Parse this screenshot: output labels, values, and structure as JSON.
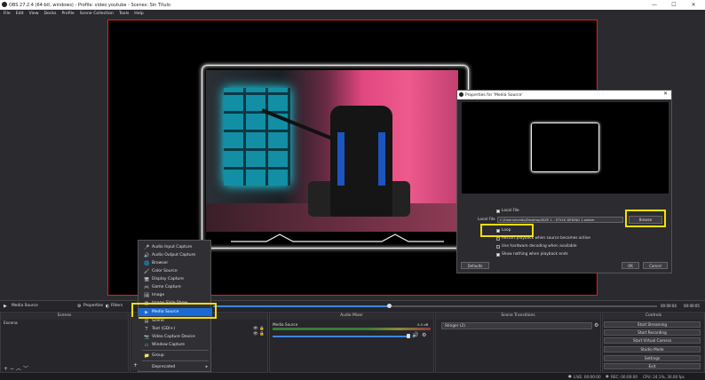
{
  "window": {
    "title": "OBS 27.2.4 (64-bit, windows) - Profile: video youtube - Scenes: Sin Título",
    "minimize": "—",
    "maximize": "☐",
    "close": "✕"
  },
  "menu": [
    "File",
    "Edit",
    "View",
    "Docks",
    "Profile",
    "Scene Collection",
    "Tools",
    "Help"
  ],
  "dialog": {
    "title": "Properties for 'Media Source'",
    "close": "✕",
    "local_file_label": "Local File",
    "local_file_field_label": "Local File",
    "local_file_value": "C:/Users/ivaldo/Desktop/SIZE 1 - STYLE DESING 1.webm",
    "browse": "Browse",
    "loop": "Loop",
    "restart": "Restart playback when source becomes active",
    "hw_decoding": "Use hardware decoding when available",
    "show_nothing": "Show nothing when playback ends",
    "defaults": "Defaults",
    "ok": "OK",
    "cancel": "Cancel"
  },
  "context_menu": {
    "items": [
      {
        "icon": "mic-icon",
        "glyph": "🎤",
        "label": "Audio Input Capture"
      },
      {
        "icon": "speaker-icon",
        "glyph": "🔊",
        "label": "Audio Output Capture"
      },
      {
        "icon": "globe-icon",
        "glyph": "🌐",
        "label": "Browser"
      },
      {
        "icon": "brush-icon",
        "glyph": "🖌",
        "label": "Color Source"
      },
      {
        "icon": "monitor-icon",
        "glyph": "🖥",
        "label": "Display Capture"
      },
      {
        "icon": "gamepad-icon",
        "glyph": "🎮",
        "label": "Game Capture"
      },
      {
        "icon": "image-icon",
        "glyph": "🖼",
        "label": "Image"
      },
      {
        "icon": "scene-icon",
        "glyph": "▦",
        "label": "Image Slide Show"
      },
      {
        "icon": "play-icon",
        "glyph": "▶",
        "label": "Media Source"
      },
      {
        "icon": "scene-icon",
        "glyph": "▤",
        "label": "Scene"
      },
      {
        "icon": "text-icon",
        "glyph": "T",
        "label": "Text (GDI+)"
      },
      {
        "icon": "camera-icon",
        "glyph": "📷",
        "label": "Video Capture Device"
      },
      {
        "icon": "window-icon",
        "glyph": "▭",
        "label": "Window Capture"
      },
      {
        "icon": "folder-icon",
        "glyph": "📁",
        "label": "Group"
      },
      {
        "icon": "",
        "glyph": "",
        "label": "Deprecated"
      }
    ]
  },
  "source_bar": {
    "source_name": "Media Source",
    "properties": "Properties",
    "filters": "Filters",
    "time_left": "00:00:04",
    "time_right": "00:00:05"
  },
  "docks": {
    "scenes": {
      "title": "Scenes",
      "items": [
        "Escena"
      ]
    },
    "sources": {
      "title": "Sources"
    },
    "audio_mixer": {
      "title": "Audio Mixer",
      "channel": "Media Source",
      "db": "0.0 dB"
    },
    "transitions": {
      "title": "Scene Transitions",
      "selected": "Stinger (2)"
    },
    "controls": {
      "title": "Controls",
      "buttons": [
        "Start Streaming",
        "Start Recording",
        "Start Virtual Camera",
        "Studio Mode",
        "Settings",
        "Exit"
      ]
    }
  },
  "status": {
    "live": "LIVE: 00:00:00",
    "rec": "REC: 00:00:00",
    "cpu": "CPU: 24.1%, 30.00 fps"
  },
  "colors": {
    "highlight": "#f5e000",
    "selection": "#1a6ad1",
    "canvas_border": "#dd2222"
  }
}
